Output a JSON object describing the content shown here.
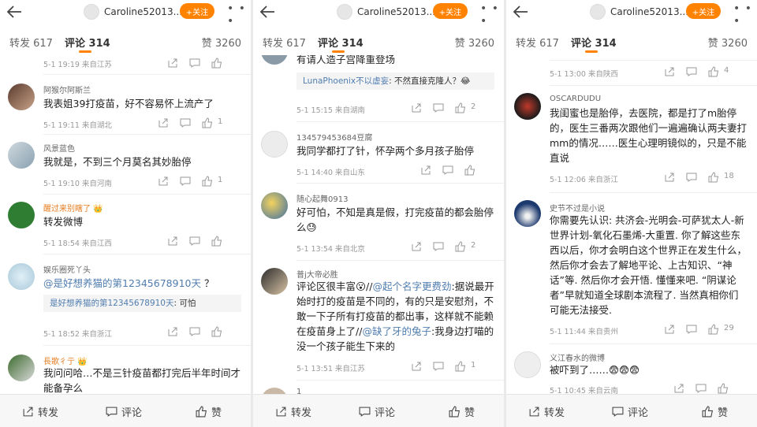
{
  "header": {
    "username": "Caroline52013...",
    "follow_label": "+关注",
    "more_label": "• • •"
  },
  "tabs": {
    "repost": "转发 617",
    "comment": "评论 314",
    "like": "赞 3260"
  },
  "bottom_bar": {
    "repost": "转发",
    "comment": "评论",
    "like": "赞"
  },
  "panels": [
    {
      "comments": [
        {
          "meta": "5-1 19:19  来自江苏"
        },
        {
          "name": "阿猴尔阿斯兰",
          "text": "我表姐39打疫苗，好不容易怀上流产了",
          "meta": "5-1 19:11  来自湖北",
          "likes": "1"
        },
        {
          "name": "风景蓝色",
          "text": "我就是，不到三个月莫名其妙胎停",
          "meta": "5-1 19:10  来自河南",
          "likes": "1"
        },
        {
          "name": "醒过来别瞎了 👑",
          "text": "转发微博",
          "meta": "5-1 18:54  来自江西"
        },
        {
          "name": "娱乐圈死丫头",
          "text_link": "@是好想养猫的第12345678910天",
          "text_rest": " ？",
          "quote_link": "是好想养猫的第12345678910天",
          "quote_rest": ": 可怕",
          "meta": "5-1 18:52  来自浙江"
        },
        {
          "name": "長歌彳亍 👑",
          "text": "我问问哈…不是三针疫苗都打完后半年时间才能备孕么"
        }
      ]
    },
    {
      "comments": [
        {
          "text": "有请人造子宫降重登场",
          "quote_link": "LunaPhoenix不以虚妄",
          "quote_rest": ": 不然直接克隆人？😂",
          "meta": "5-1 15:15  来自湖南",
          "likes": "2"
        },
        {
          "name": "134579453684豆腐",
          "text": "我同学都打了针，怀孕两个多月孩子胎停",
          "meta": "5-1 14:40  来自山东"
        },
        {
          "name": "随心起舞0913",
          "text": "好可怕，不知是真是假，打完疫苗的都会胎停么😓",
          "meta": "5-1 13:54  来自北京",
          "likes": "2"
        },
        {
          "name": "普j大帝必胜",
          "text_a": "评论区很丰富😮//",
          "link_a": "@起个名字更费劲",
          "text_b": ":据说最开始时打的疫苗是不同的，有的只是安慰剂，不敢一下子所有打疫苗的都出事，这样就不能赖在疫苗身上了//",
          "link_b": "@缺了牙的兔子",
          "text_c": ":我身边打喵的没一个孩子能生下来的",
          "meta": "5-1 13:51  来自江苏",
          "likes": "1"
        },
        {
          "name": "1"
        }
      ]
    },
    {
      "comments": [
        {
          "meta": "5-1 13:00  来自陕西",
          "likes": "4"
        },
        {
          "name": "OSCARDUDU",
          "text": "我闺蜜也是胎停，去医院，都是打了m胎停的，医生三番两次跟他们一遍遍确认两夫妻打mm的情况……医生心理明镜似的，只是不能直说",
          "meta": "5-1 12:06  来自浙江",
          "likes": "18"
        },
        {
          "name": "史节不过是小说",
          "text": "你需要先认识: 共济会-光明会-可萨犹太人-新世界计划-氧化石墨烯-大重置. 你了解这些东西以后，你才会明白这个世界正在发生什么，然后你才会去了解地平论、上古知识、“神话”等.  然后你才会开悟. 懂懂来吧.  “阴谋论者”早就知道全球剧本流程了. 当然真相你们可能无法接受.",
          "meta": "5-1 11:44  来自贵州",
          "likes": "29"
        },
        {
          "name": "义江春水的微博",
          "text": "被吓到了……😨😨😨",
          "meta": "5-1 10:45  来自云南"
        }
      ]
    }
  ]
}
